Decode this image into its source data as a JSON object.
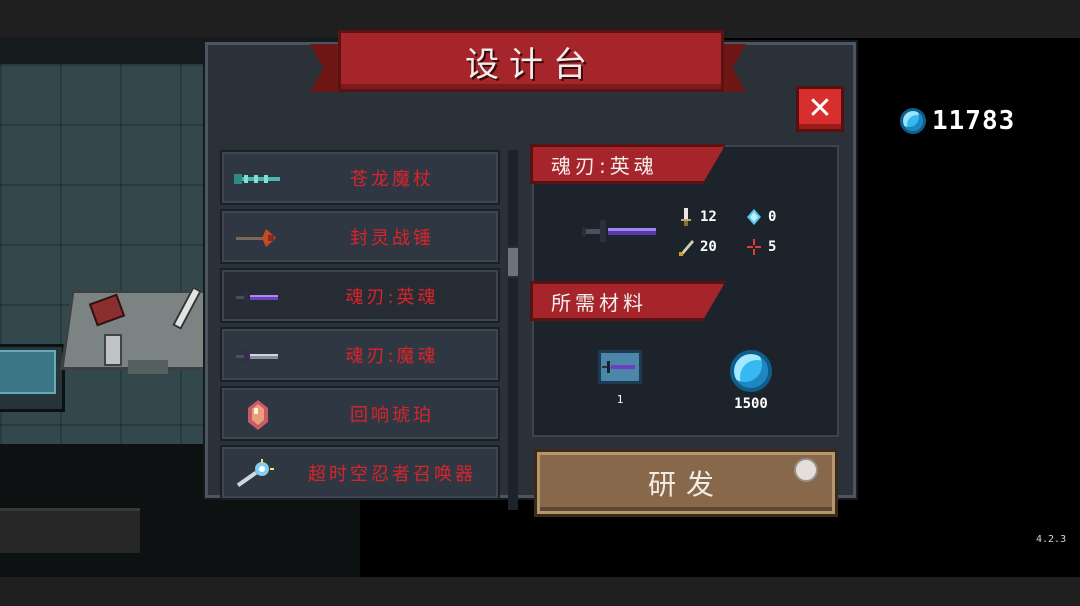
{
  "title": "设计台",
  "close_label": "✕",
  "currency": {
    "icon": "blue-gem-icon",
    "value": "11783",
    "color": "#36b9f0"
  },
  "version": "4.2.3",
  "items": [
    {
      "label": "苍龙魔杖",
      "icon": "dragon-staff-icon"
    },
    {
      "label": "封灵战锤",
      "icon": "spirit-warhammer-icon"
    },
    {
      "label": "魂刃:英魂",
      "icon": "soul-blade-icon",
      "selected": true
    },
    {
      "label": "魂刃:魔魂",
      "icon": "demon-soul-blade-icon"
    },
    {
      "label": "回响琥珀",
      "icon": "echo-amber-icon"
    },
    {
      "label": "超时空忍者召唤器",
      "icon": "time-ninja-summoner-icon"
    }
  ],
  "detail": {
    "name": "魂刃:英魂",
    "stats": {
      "damage": "12",
      "energy": "0",
      "crit": "20",
      "spread": "5"
    },
    "materials_title": "所需材料",
    "materials": [
      {
        "icon": "blueprint-icon",
        "qty": "1"
      },
      {
        "icon": "blue-gem-icon",
        "qty": "1500"
      }
    ]
  },
  "research_label": "研发",
  "colors": {
    "accent": "#a5252a",
    "item_text": "#d9242c",
    "button": "#87684a"
  }
}
